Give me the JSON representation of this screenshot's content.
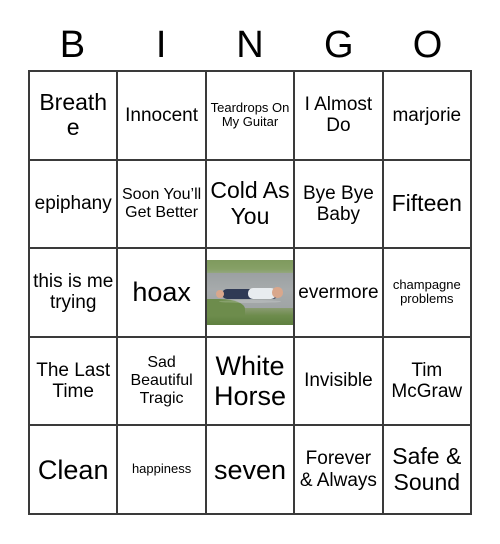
{
  "header": {
    "letters": [
      "B",
      "I",
      "N",
      "G",
      "O"
    ]
  },
  "grid": {
    "columns": 5,
    "rows": 5,
    "border_color": "#3a3a3a",
    "background_color": "#ffffff",
    "text_color": "#000000"
  },
  "cells": [
    {
      "text": "Breathe",
      "size": "lg",
      "type": "text"
    },
    {
      "text": "Innocent",
      "size": "md",
      "type": "text"
    },
    {
      "text": "Teardrops On My Guitar",
      "size": "xs",
      "type": "text"
    },
    {
      "text": "I Almost Do",
      "size": "md",
      "type": "text"
    },
    {
      "text": "marjorie",
      "size": "md",
      "type": "text"
    },
    {
      "text": "epiphany",
      "size": "md",
      "type": "text"
    },
    {
      "text": "Soon You’ll Get Better",
      "size": "sm",
      "type": "text"
    },
    {
      "text": "Cold As You",
      "size": "lg",
      "type": "text"
    },
    {
      "text": "Bye Bye Baby",
      "size": "md",
      "type": "text"
    },
    {
      "text": "Fifteen",
      "size": "lg",
      "type": "text"
    },
    {
      "text": "this is me trying",
      "size": "md",
      "type": "text"
    },
    {
      "text": "hoax",
      "size": "xl",
      "type": "text"
    },
    {
      "text": "",
      "size": "md",
      "type": "image",
      "image_name": "free-space-photo",
      "image_description": "person lying in shallow water beside grass"
    },
    {
      "text": "evermore",
      "size": "md",
      "type": "text"
    },
    {
      "text": "champagne problems",
      "size": "xs",
      "type": "text"
    },
    {
      "text": "The Last Time",
      "size": "md",
      "type": "text"
    },
    {
      "text": "Sad Beautiful Tragic",
      "size": "sm",
      "type": "text"
    },
    {
      "text": "White Horse",
      "size": "xl",
      "type": "text"
    },
    {
      "text": "Invisible",
      "size": "md",
      "type": "text"
    },
    {
      "text": "Tim McGraw",
      "size": "md",
      "type": "text"
    },
    {
      "text": "Clean",
      "size": "xl",
      "type": "text"
    },
    {
      "text": "happiness",
      "size": "xs",
      "type": "text"
    },
    {
      "text": "seven",
      "size": "xl",
      "type": "text"
    },
    {
      "text": "Forever & Always",
      "size": "md",
      "type": "text"
    },
    {
      "text": "Safe & Sound",
      "size": "lg",
      "type": "text"
    }
  ]
}
